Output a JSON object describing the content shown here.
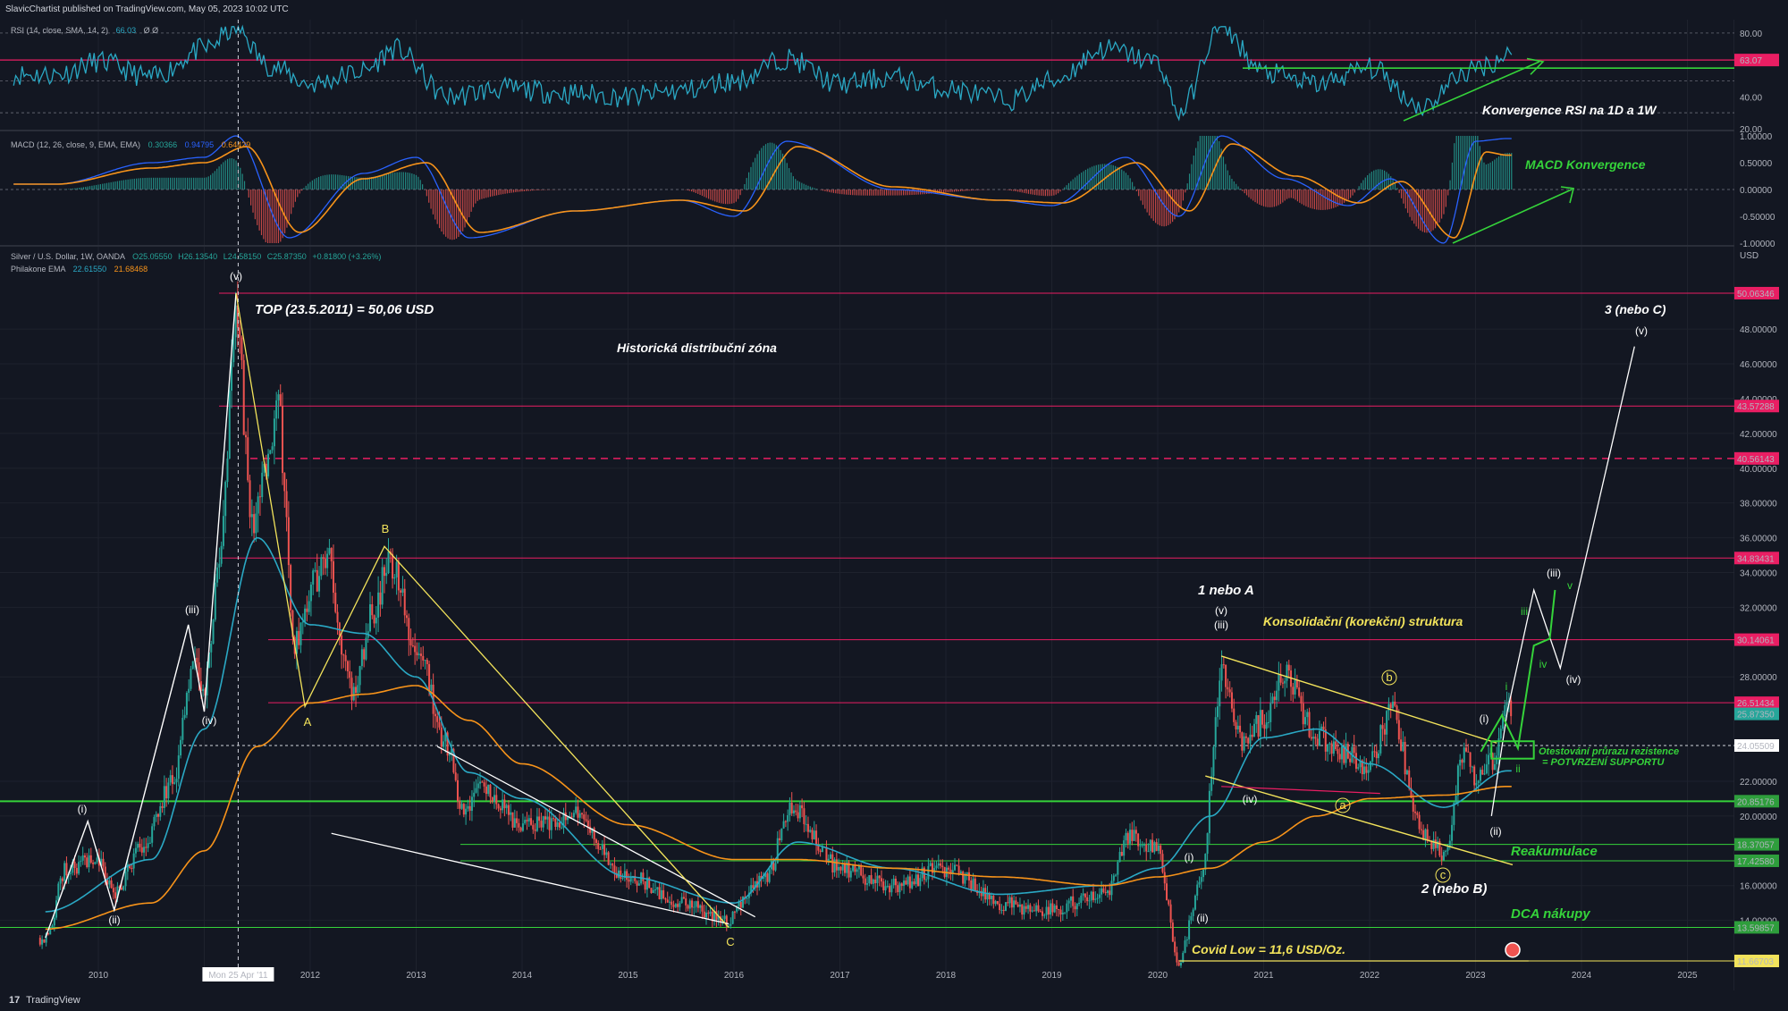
{
  "header": {
    "publisher": "SlavicChartist published on TradingView.com, May 05, 2023 10:02 UTC"
  },
  "footer": {
    "brand": "TradingView",
    "logo": "17"
  },
  "legends": {
    "rsi_label": "RSI (14, close, SMA, 14, 2)",
    "rsi_value": "66.03",
    "rsi_tail": "Ø Ø",
    "macd_label": "MACD (12, 26, close, 9, EMA, EMA)",
    "macd_v1": "0.30366",
    "macd_v2": "0.94795",
    "macd_v3": "0.64429",
    "symbol": "Silver / U.S. Dollar, 1W, OANDA",
    "ohlc_o": "O25.05550",
    "ohlc_h": "H26.13540",
    "ohlc_l": "L24.58150",
    "ohlc_c": "C25.87350",
    "ohlc_chg": "+0.81800 (+3.26%)",
    "ema_label": "Philakone EMA",
    "ema_v1": "22.61550",
    "ema_v2": "21.68468",
    "currency": "USD"
  },
  "colors": {
    "background": "#131722",
    "candle_up": "#26a69a",
    "candle_down": "#ef5350",
    "ema_fast": "#2aa8c4",
    "ema_slow": "#f7931a",
    "rsi_line": "#2aa8c4",
    "macd_line": "#2962ff",
    "signal_line": "#f7931a",
    "resistance": "#e91e63",
    "support": "#35d33a",
    "annotation_yellow": "#f2e35b"
  },
  "chart_data": [
    {
      "type": "line",
      "panel": "RSI",
      "title": "RSI (14, close, SMA, 14, 2)",
      "y_ticks": [
        "80.00",
        "40.00",
        "20.00"
      ],
      "ylim": [
        20,
        85
      ],
      "current_value": "63.07",
      "x": [
        2009.6,
        2010.0,
        2010.5,
        2011.0,
        2011.3,
        2011.6,
        2012.0,
        2012.5,
        2012.8,
        2013.3,
        2013.8,
        2014.5,
        2015.0,
        2015.5,
        2016.0,
        2016.5,
        2017.0,
        2017.5,
        2018.0,
        2018.6,
        2019.0,
        2019.5,
        2020.0,
        2020.2,
        2020.6,
        2021.0,
        2021.5,
        2022.0,
        2022.5,
        2022.9,
        2023.1,
        2023.3
      ],
      "values": [
        54,
        62,
        52,
        70,
        83,
        60,
        48,
        56,
        70,
        40,
        45,
        42,
        40,
        44,
        50,
        64,
        48,
        52,
        45,
        38,
        50,
        70,
        62,
        30,
        84,
        55,
        48,
        58,
        34,
        55,
        60,
        66
      ],
      "annotations": [
        "Konvergence RSI na 1D a 1W"
      ]
    },
    {
      "type": "line",
      "panel": "MACD",
      "title": "MACD (12, 26, close, 9, EMA, EMA)",
      "y_ticks": [
        "1.00000",
        "0.50000",
        "0.00000",
        "-0.50000",
        "-1.00000"
      ],
      "ylim": [
        -1.0,
        1.0
      ],
      "series": [
        {
          "name": "MACD",
          "x": [
            2009.6,
            2010.5,
            2011.0,
            2011.3,
            2011.8,
            2012.5,
            2013.0,
            2013.5,
            2014.5,
            2015.5,
            2016.0,
            2016.5,
            2017.5,
            2018.5,
            2019.0,
            2019.7,
            2020.2,
            2020.6,
            2021.2,
            2021.8,
            2022.2,
            2022.7,
            2023.0,
            2023.3
          ],
          "values": [
            0.1,
            0.5,
            0.6,
            1.0,
            -0.9,
            0.3,
            0.6,
            -0.9,
            -0.4,
            -0.2,
            -0.5,
            0.9,
            0.0,
            -0.2,
            -0.3,
            0.6,
            -0.5,
            1.0,
            0.2,
            -0.3,
            0.2,
            -1.0,
            0.9,
            0.95
          ]
        },
        {
          "name": "Signal",
          "x": [
            2009.6,
            2010.5,
            2011.0,
            2011.4,
            2011.9,
            2012.5,
            2013.1,
            2013.6,
            2014.5,
            2015.5,
            2016.1,
            2016.6,
            2017.5,
            2018.5,
            2019.1,
            2019.8,
            2020.3,
            2020.7,
            2021.3,
            2021.9,
            2022.3,
            2022.8,
            2023.1,
            2023.3
          ],
          "values": [
            0.1,
            0.4,
            0.5,
            0.8,
            -0.8,
            0.2,
            0.5,
            -0.8,
            -0.4,
            -0.2,
            -0.4,
            0.8,
            0.05,
            -0.2,
            -0.25,
            0.5,
            -0.4,
            0.85,
            0.25,
            -0.25,
            0.15,
            -0.9,
            0.7,
            0.64
          ]
        }
      ],
      "annotations": [
        "MACD Konvergence"
      ]
    },
    {
      "type": "line",
      "panel": "Price",
      "title": "Silver / U.S. Dollar, 1W, OANDA",
      "ylabel": "USD",
      "ylim": [
        11.0,
        51.5
      ],
      "x_ticks": [
        "2010",
        "2011",
        "2012",
        "2013",
        "2014",
        "2015",
        "2016",
        "2017",
        "2018",
        "2019",
        "2020",
        "2021",
        "2022",
        "2023",
        "2024",
        "2025"
      ],
      "y_ticks": [
        "48.00000",
        "46.00000",
        "44.00000",
        "42.00000",
        "40.00000",
        "38.00000",
        "36.00000",
        "34.00000",
        "32.00000",
        "28.00000",
        "22.00000",
        "20.00000",
        "16.00000",
        "14.00000"
      ],
      "crosshair_date": "Mon 25 Apr '11",
      "series": [
        {
          "name": "Silver / U.S. Dollar",
          "x": [
            2009.5,
            2009.7,
            2010.0,
            2010.15,
            2010.4,
            2010.7,
            2010.9,
            2011.0,
            2011.15,
            2011.3,
            2011.45,
            2011.6,
            2011.7,
            2011.85,
            2012.0,
            2012.15,
            2012.4,
            2012.6,
            2012.75,
            2013.0,
            2013.3,
            2013.45,
            2013.6,
            2014.0,
            2014.5,
            2015.0,
            2015.5,
            2015.9,
            2016.3,
            2016.55,
            2017.0,
            2017.5,
            2018.0,
            2018.5,
            2018.9,
            2019.5,
            2019.75,
            2020.0,
            2020.2,
            2020.4,
            2020.6,
            2020.8,
            2021.0,
            2021.2,
            2021.5,
            2022.0,
            2022.2,
            2022.5,
            2022.7,
            2022.9,
            2023.0,
            2023.15,
            2023.3
          ],
          "values": [
            13.0,
            17.0,
            17.5,
            15.5,
            18.0,
            22.0,
            29.0,
            27.0,
            35.0,
            48.5,
            37.0,
            40.0,
            43.0,
            30.0,
            33.0,
            35.0,
            27.0,
            32.0,
            34.5,
            30.0,
            24.0,
            20.0,
            22.0,
            19.5,
            20.0,
            16.5,
            15.0,
            14.0,
            16.5,
            20.5,
            17.0,
            16.0,
            17.0,
            15.0,
            14.5,
            15.5,
            19.0,
            18.0,
            11.6,
            16.0,
            28.0,
            24.0,
            25.5,
            28.0,
            24.5,
            23.0,
            26.0,
            19.0,
            17.8,
            24.0,
            22.0,
            23.0,
            25.87
          ]
        },
        {
          "name": "Philakone EMA (fast)",
          "x": [
            2009.5,
            2010.5,
            2011.0,
            2011.5,
            2012.0,
            2012.5,
            2013.0,
            2013.5,
            2014.0,
            2015.0,
            2016.0,
            2016.6,
            2017.5,
            2018.5,
            2019.5,
            2020.0,
            2020.5,
            2021.0,
            2021.5,
            2022.0,
            2022.7,
            2023.3
          ],
          "values": [
            14.5,
            17.5,
            25.0,
            36.0,
            31.0,
            30.5,
            28.0,
            22.5,
            21.0,
            16.5,
            15.0,
            18.5,
            17.0,
            15.5,
            16.0,
            17.0,
            20.0,
            24.5,
            25.0,
            23.0,
            20.5,
            22.6
          ]
        },
        {
          "name": "Philakone EMA (slow)",
          "x": [
            2009.5,
            2010.5,
            2011.0,
            2011.5,
            2012.0,
            2012.5,
            2013.0,
            2013.5,
            2014.0,
            2015.0,
            2016.0,
            2016.6,
            2017.5,
            2018.5,
            2019.5,
            2020.0,
            2020.5,
            2021.0,
            2021.5,
            2022.0,
            2022.7,
            2023.3
          ],
          "values": [
            13.5,
            15.0,
            18.0,
            24.0,
            26.5,
            27.0,
            27.5,
            25.5,
            23.0,
            19.5,
            17.5,
            17.5,
            17.0,
            16.5,
            16.0,
            16.5,
            17.0,
            18.5,
            20.0,
            21.0,
            21.2,
            21.7
          ]
        }
      ],
      "levels": [
        {
          "value": 50.06346,
          "label": "50.06346",
          "kind": "resistance"
        },
        {
          "value": 43.57288,
          "label": "43.57288",
          "kind": "resistance"
        },
        {
          "value": 40.56143,
          "label": "40.56143",
          "kind": "resistance-dashed"
        },
        {
          "value": 34.83431,
          "label": "34.83431",
          "kind": "resistance"
        },
        {
          "value": 30.14061,
          "label": "30.14061",
          "kind": "resistance"
        },
        {
          "value": 26.51434,
          "label": "26.51434",
          "kind": "resistance"
        },
        {
          "value": 25.8735,
          "label": "25.87350",
          "kind": "last"
        },
        {
          "value": 24.05509,
          "label": "24.05509",
          "kind": "dotted"
        },
        {
          "value": 20.85176,
          "label": "20.85176",
          "kind": "support"
        },
        {
          "value": 18.37057,
          "label": "18.37057",
          "kind": "support"
        },
        {
          "value": 17.4258,
          "label": "17.42580",
          "kind": "support"
        },
        {
          "value": 13.59857,
          "label": "13.59857",
          "kind": "support"
        },
        {
          "value": 11.66703,
          "label": "11.66703",
          "kind": "low"
        }
      ],
      "annotations": [
        {
          "text": "TOP (23.5.2011) = 50,06 USD",
          "color": "white"
        },
        {
          "text": "Historická distribuční zóna",
          "color": "white"
        },
        {
          "text": "3 (nebo C)",
          "color": "white"
        },
        {
          "text": "1 nebo A",
          "color": "white"
        },
        {
          "text": "Konsolidační (korekční) struktura",
          "color": "yellow"
        },
        {
          "text": "Otestování průrazu rezistence",
          "color": "green"
        },
        {
          "text": "= POTVRZENÍ SUPPORTU",
          "color": "green"
        },
        {
          "text": "Reakumulace",
          "color": "green"
        },
        {
          "text": "2 (nebo B)",
          "color": "white"
        },
        {
          "text": "DCA nákupy",
          "color": "green"
        },
        {
          "text": "Covid Low = 11,6 USD/Oz.",
          "color": "yellow"
        }
      ],
      "wave_labels": [
        "(v)",
        "(iii)",
        "(iv)",
        "(i)",
        "(ii)",
        "A",
        "B",
        "C",
        "(v)",
        "(iii)",
        "(iv)",
        "(i)",
        "(ii)",
        "a",
        "b",
        "c",
        "(i)",
        "(ii)",
        "(iii)",
        "(iv)",
        "(v)",
        "i",
        "ii",
        "iii",
        "iv",
        "v"
      ]
    }
  ]
}
